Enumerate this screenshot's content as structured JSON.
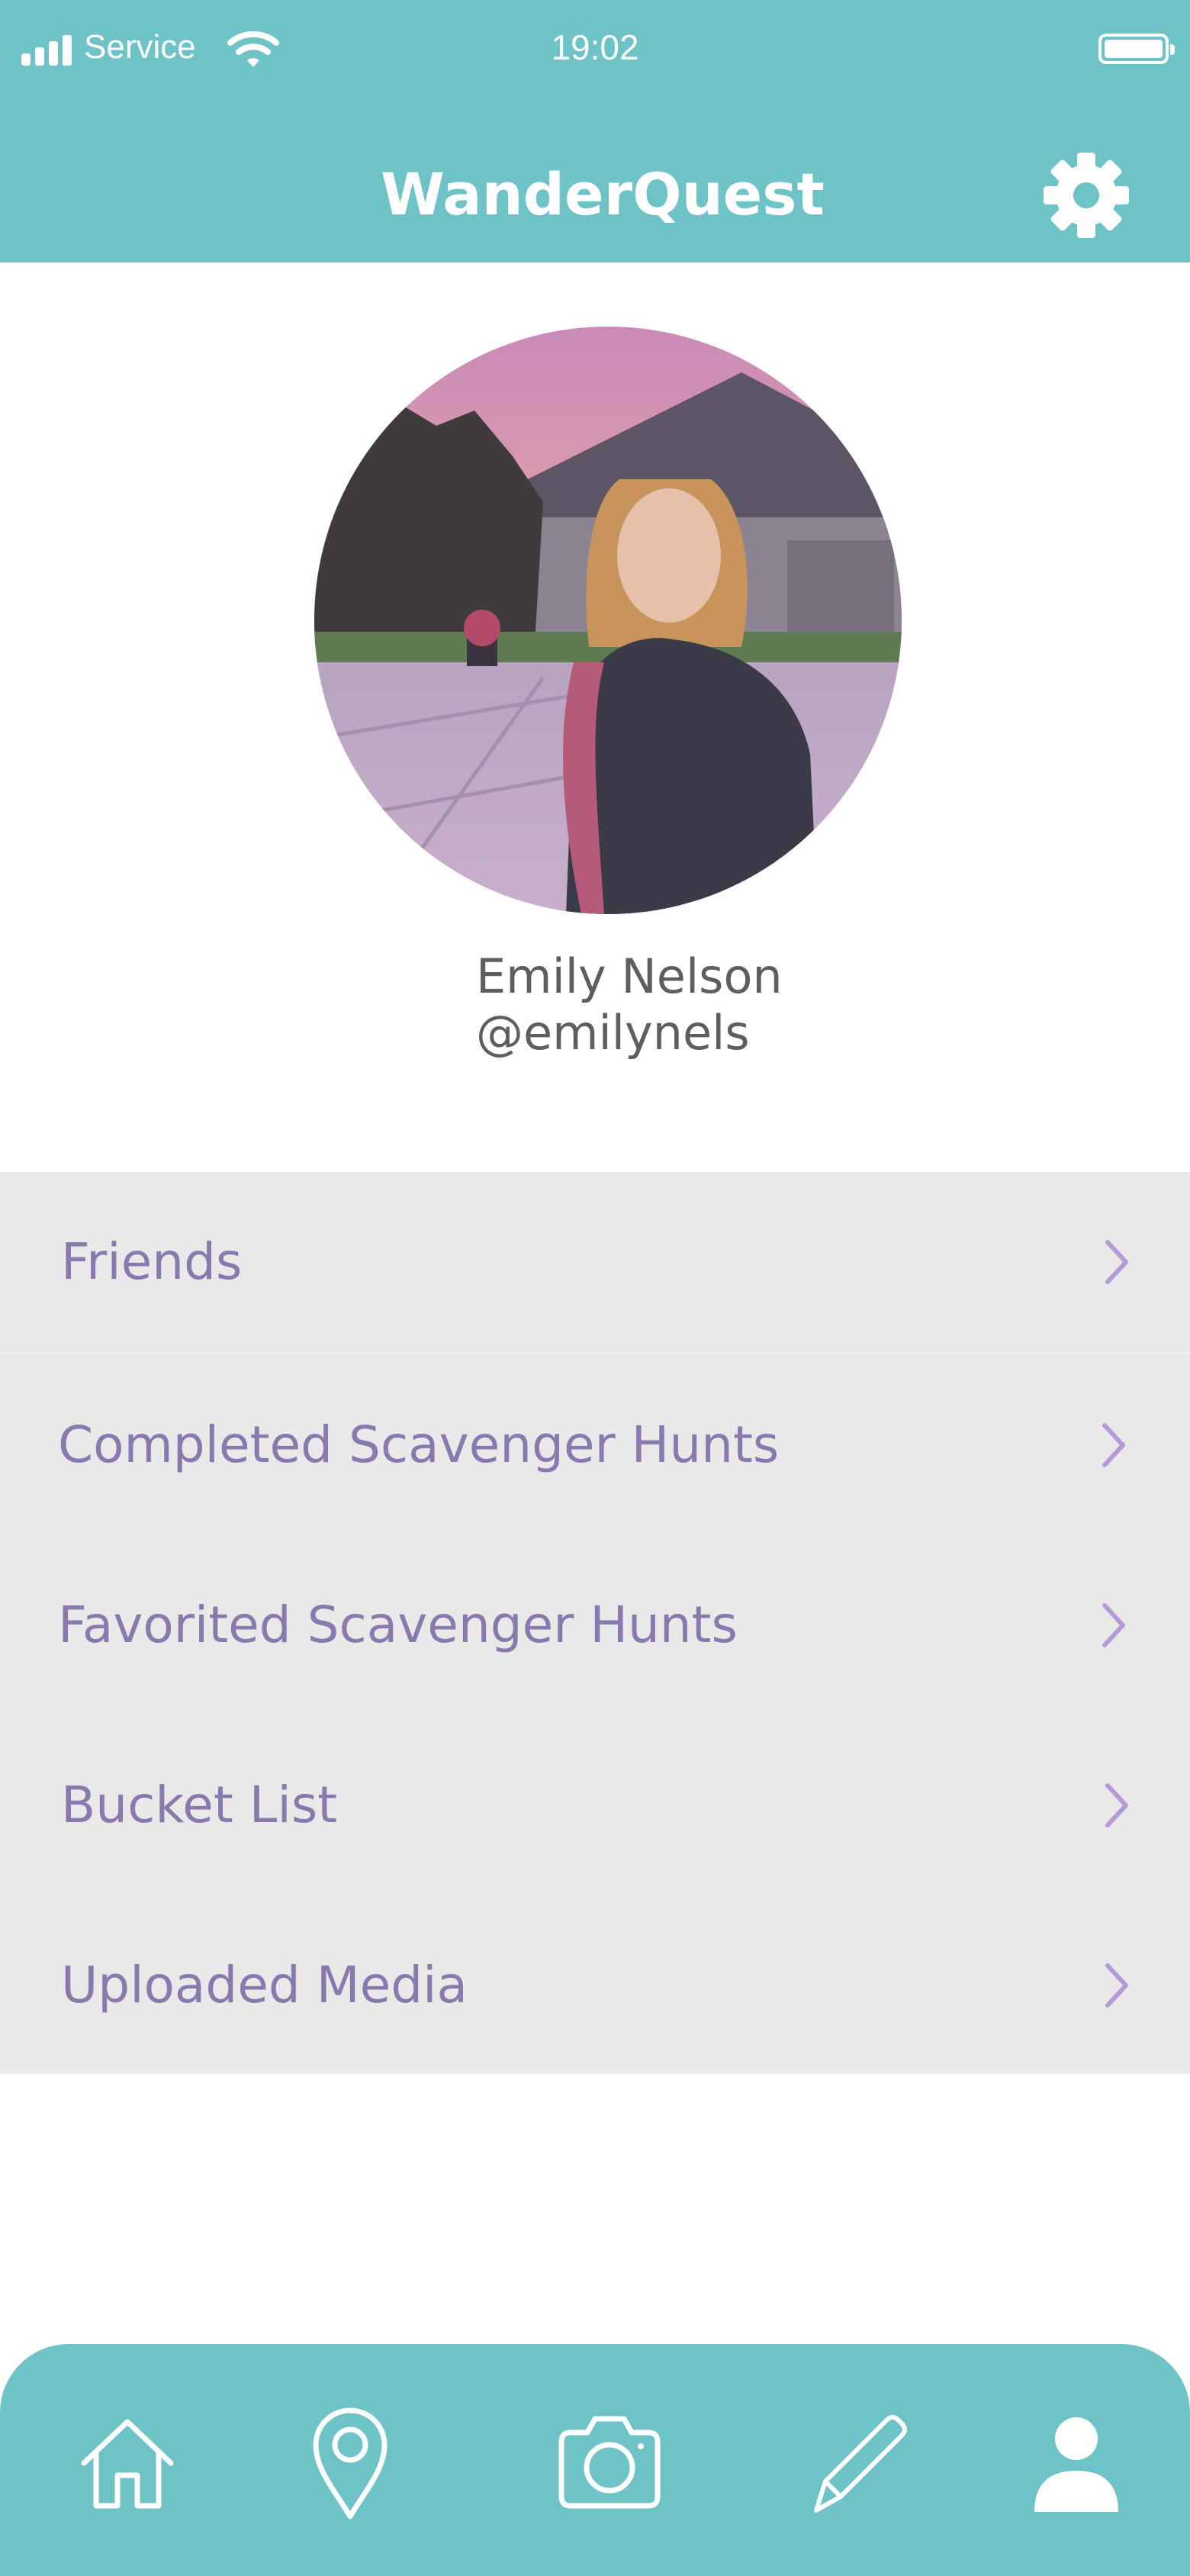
{
  "status_bar": {
    "carrier": "Service",
    "time": "19:02"
  },
  "header": {
    "app_title": "WanderQuest",
    "settings_icon": "gear-icon"
  },
  "profile": {
    "name": "Emily Nelson",
    "handle": "@emilynels"
  },
  "menu": {
    "items": [
      {
        "label": "Friends",
        "icon": "chevron-right-icon"
      },
      {
        "label": "Completed Scavenger Hunts",
        "icon": "chevron-right-icon"
      },
      {
        "label": "Favorited Scavenger Hunts",
        "icon": "chevron-right-icon"
      },
      {
        "label": "Bucket List",
        "icon": "chevron-right-icon"
      },
      {
        "label": "Uploaded Media",
        "icon": "chevron-right-icon"
      }
    ]
  },
  "tab_bar": {
    "tabs": [
      {
        "icon": "home-icon"
      },
      {
        "icon": "map-pin-icon"
      },
      {
        "icon": "camera-icon"
      },
      {
        "icon": "pencil-icon"
      },
      {
        "icon": "profile-icon",
        "active": true
      }
    ]
  },
  "colors": {
    "accent_teal": "#6ec3c7",
    "menu_background": "#e9e9ea",
    "menu_text": "#8a79ad",
    "chevron": "#b49ad6",
    "profile_text": "#5e5e5e"
  }
}
